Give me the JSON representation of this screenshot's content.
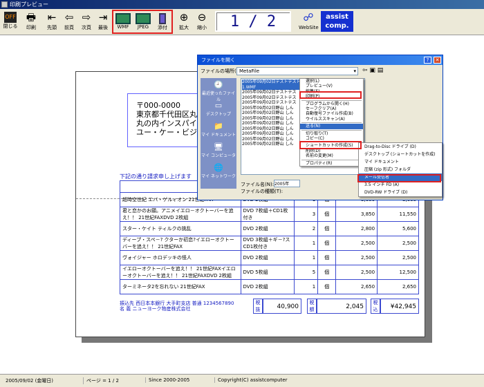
{
  "window": {
    "title": "印刷プレビュー"
  },
  "toolbar": {
    "close": "閉じる",
    "print": "印刷",
    "first": "先頭",
    "prev": "前頁",
    "next": "次頁",
    "last": "最後",
    "wmf": "WMF",
    "jpeg": "JPEG",
    "pdf": "添付",
    "zoom_in": "拡大",
    "zoom_out": "縮小",
    "page": "1 / 2",
    "website": "WebSite",
    "brand1": "assist",
    "brand2": "comp."
  },
  "doc": {
    "zip": "〒000-0000",
    "addr1": "東京都千代田区丸の",
    "addr2": "丸の内インスパイア",
    "addr3": "ユー・ケー・ビジュア",
    "note": "下記の通り請求申し上げます",
    "header": "商　品　名",
    "rows": [
      {
        "name": "超時空世紀 エバ・ゲルィオン 21世紀FAX",
        "spec": "DVD 2枚組",
        "qty": "1",
        "unit": "個",
        "price": "3,600",
        "amount": "3,600"
      },
      {
        "name": "君と恋かのお願。アニメイエロ－オクトーバーを追え！！ 21世紀FAXDVD 2枚組",
        "spec": "DVD 7枚組＋CD1枚付き",
        "qty": "3",
        "unit": "個",
        "price": "3,850",
        "amount": "11,550"
      },
      {
        "name": "スター・ケイト ティルクの挑乱",
        "spec": "DVD 2枚組",
        "qty": "2",
        "unit": "個",
        "price": "2,800",
        "amount": "5,600"
      },
      {
        "name": "ディープ・スペ－? クターか初恋?イエローオクトーバーを追え！！ 21世紀FAX",
        "spec": "DVD 3枚組＋ギ－?スCD1枚付き",
        "qty": "1",
        "unit": "個",
        "price": "2,500",
        "amount": "2,500"
      },
      {
        "name": "ヴォイジャー ホロデッキの怪人",
        "spec": "DVD 2枚組",
        "qty": "1",
        "unit": "個",
        "price": "2,500",
        "amount": "2,500"
      },
      {
        "name": "イエローオクトーバーを追え！！ 21世紀FAXイエローオクトーバーを追え！！ 21世紀FAXDVD 2枚組",
        "spec": "DVD 5枚組",
        "qty": "5",
        "unit": "個",
        "price": "2,500",
        "amount": "12,500"
      },
      {
        "name": "ターミネータ2を忘れない 21世紀FAX",
        "spec": "DVD 2枚組",
        "qty": "1",
        "unit": "個",
        "price": "2,650",
        "amount": "2,650"
      }
    ],
    "bank1": "振込先 西日本本銀行 大手町支店 普通 1234567890",
    "bank2": "名 義 ニューヨーク物産株式会社",
    "tax_ex_label": "税抜",
    "tax_ex": "40,900",
    "tax_label": "税額",
    "tax": "2,045",
    "tax_in_label": "税込",
    "total": "¥42,945"
  },
  "dialog": {
    "title": "ファイルを開く",
    "lookin_label": "ファイルの場所(I):",
    "lookin_value": "MetaFile",
    "places": [
      "最近使ったファイル",
      "デスクトップ",
      "マイ ドキュメント",
      "マイ コンピュータ",
      "マイ ネットワーク"
    ],
    "files": [
      "2005年09月02日テストテストテスト株式会社ー印鑑テー1.WMF",
      "2005年09月02日テストテス",
      "2005年09月02日テストテス",
      "2005年09月02日テストテス",
      "2005年09月02日野山 しん",
      "2005年09月02日野山 しん",
      "2005年09月02日野山 しん",
      "2005年09月02日野山 しん",
      "2005年09月02日野山 しん",
      "2005年09月02日野山 しん",
      "2005年09月02日野山 しん",
      "2005年09月02日野山 しん"
    ],
    "filename_label": "ファイル名(N):",
    "filename_value": "2005年",
    "filetype_label": "ファイルの種類(T):"
  },
  "context": {
    "items": [
      "選択(L)",
      "プレビュー(V)",
      "編集(E)",
      "印刷(P)",
      "プログラムから開く(H)",
      "セーフクリア(A)",
      "自動復号ファイル作成(B)",
      "ウイルススキャン(A)",
      "送る(N)",
      "切り取り(T)",
      "コピー(C)",
      "ショートカットの作成(S)",
      "削除(D)",
      "名前の変更(M)",
      "プロパティ(R)"
    ]
  },
  "sendto": {
    "items": [
      "Drag-to-Disc ドライブ (D)",
      "デスクトップ (ショートカットを作成)",
      "マイ ドキュメント",
      "圧縮 (zip 形式) フォルダ",
      "メール受信者",
      "3.5 インチ FD (A)",
      "DVD-RW ドライブ (D)"
    ]
  },
  "status": {
    "date": "2005/09/02 (金曜日)",
    "page": "ページ = 1 / 2",
    "since": "Since 2000-2005",
    "copyright": "Copyright(C) assistcomputer"
  }
}
